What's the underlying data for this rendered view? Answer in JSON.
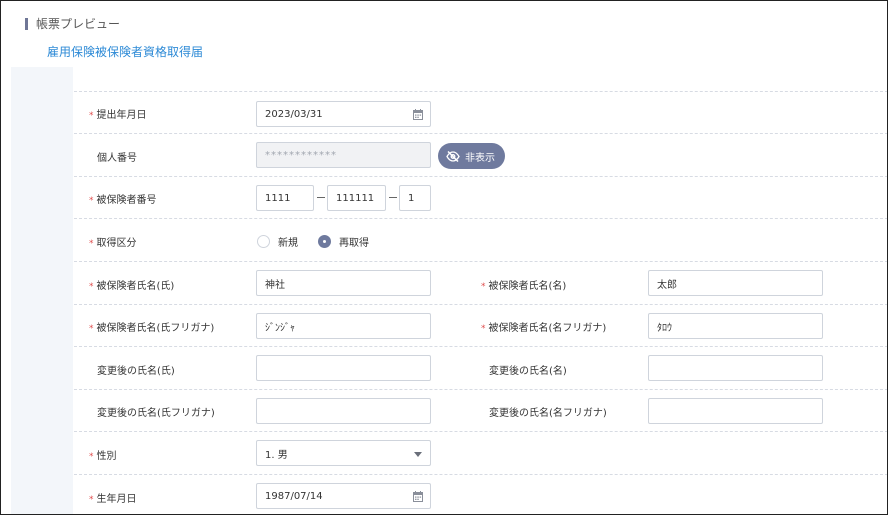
{
  "header": {
    "section_title": "帳票プレビュー",
    "document_link": "雇用保険被保険者資格取得届"
  },
  "form": {
    "submit_date": {
      "label": "提出年月日",
      "required": "*",
      "value": "2023/03/31",
      "icon": "calendar-icon"
    },
    "my_number": {
      "label": "個人番号",
      "value": "************",
      "hide_button": "非表示",
      "hide_icon": "eye-slash-icon"
    },
    "insured_number": {
      "label": "被保険者番号",
      "required": "*",
      "part1": "1111",
      "part2": "111111",
      "part3": "1"
    },
    "acquisition_type": {
      "label": "取得区分",
      "required": "*",
      "options": [
        "新規",
        "再取得"
      ],
      "selected": "再取得"
    },
    "last_name": {
      "label": "被保険者氏名(氏)",
      "required": "*",
      "value": "神社"
    },
    "first_name": {
      "label": "被保険者氏名(名)",
      "required": "*",
      "value": "太郎"
    },
    "last_name_kana": {
      "label": "被保険者氏名(氏フリガナ)",
      "required": "*",
      "value": "ｼﾞﾝｼﾞｬ"
    },
    "first_name_kana": {
      "label": "被保険者氏名(名フリガナ)",
      "required": "*",
      "value": "ﾀﾛｳ"
    },
    "changed_last_name": {
      "label": "変更後の氏名(氏)",
      "value": ""
    },
    "changed_first_name": {
      "label": "変更後の氏名(名)",
      "value": ""
    },
    "changed_last_name_kana": {
      "label": "変更後の氏名(氏フリガナ)",
      "value": ""
    },
    "changed_first_name_kana": {
      "label": "変更後の氏名(名フリガナ)",
      "value": ""
    },
    "gender": {
      "label": "性別",
      "required": "*",
      "value": "1. 男"
    },
    "birth_date": {
      "label": "生年月日",
      "required": "*",
      "value": "1987/07/14",
      "icon": "calendar-icon"
    }
  },
  "colors": {
    "accent": "#6f7a9e",
    "link": "#2d8ad6",
    "required": "#e04f4f"
  }
}
